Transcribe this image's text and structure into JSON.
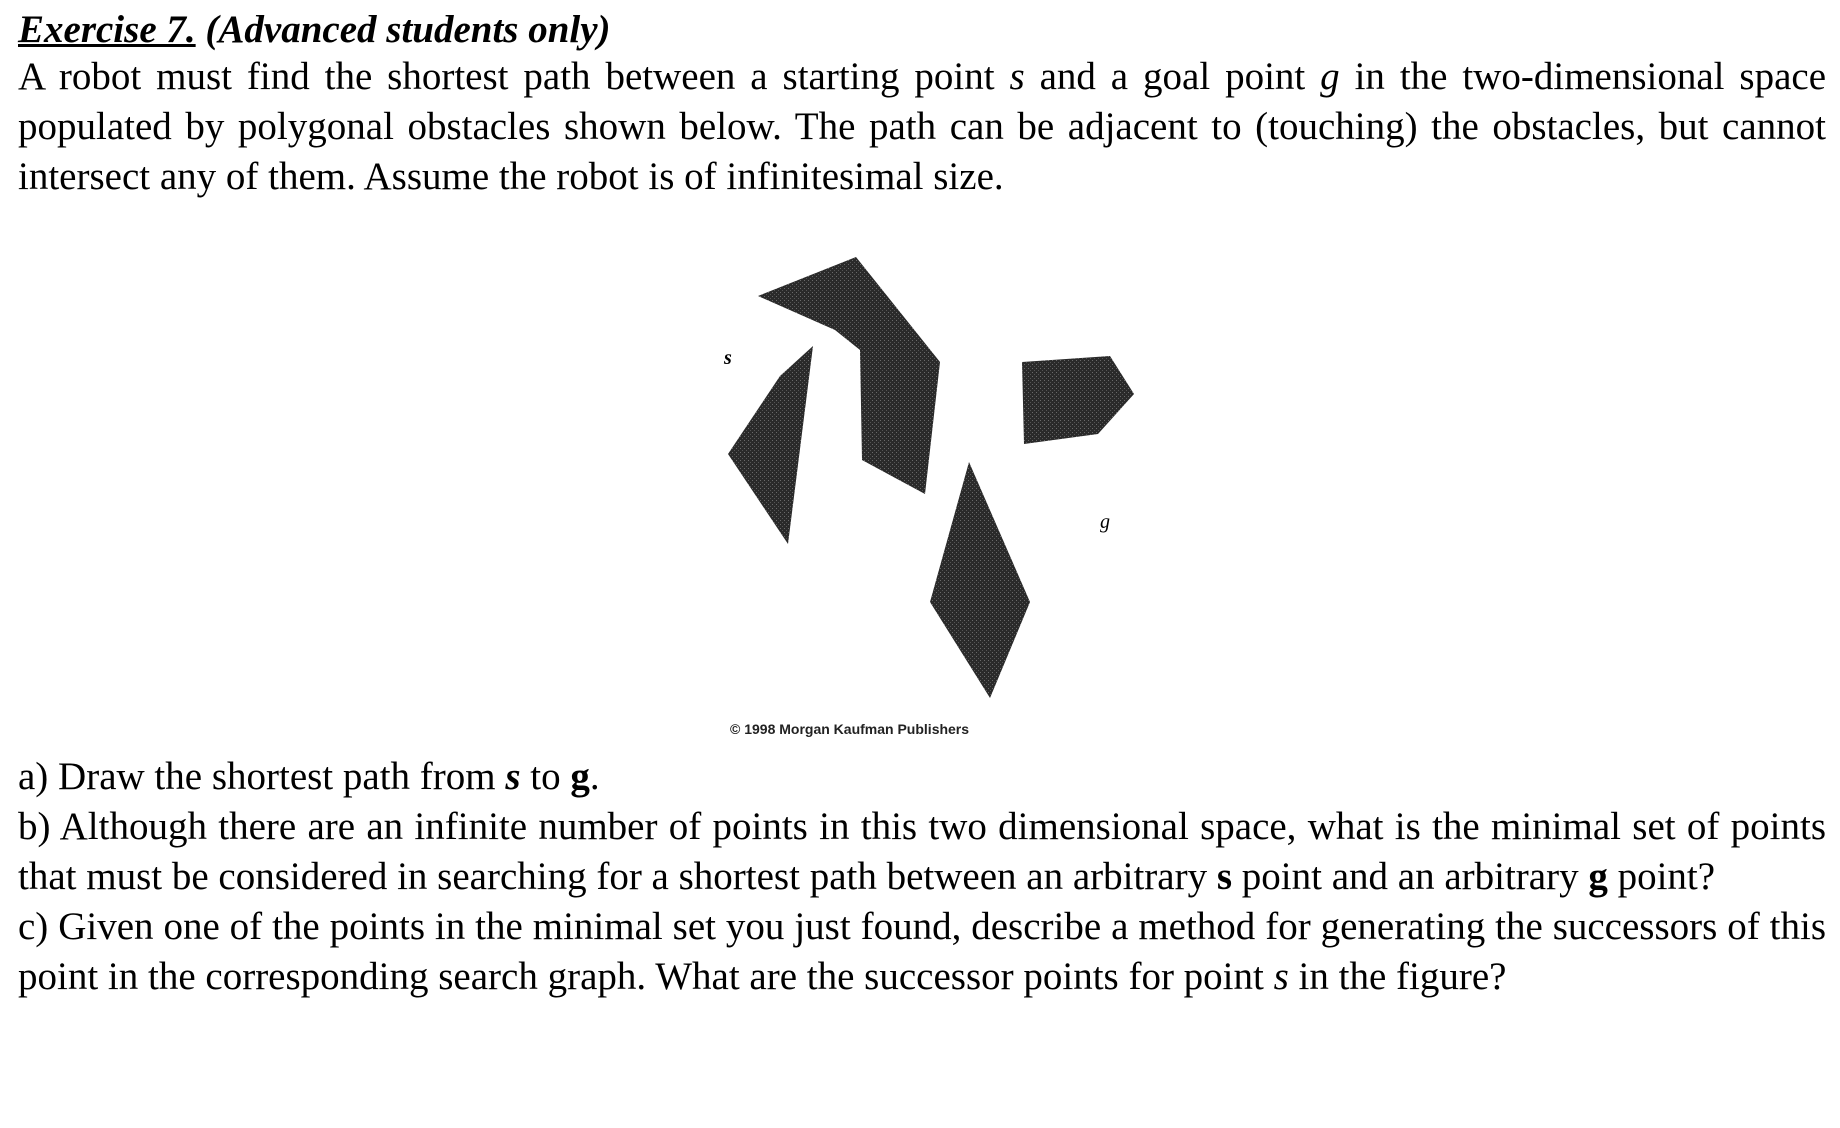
{
  "exercise": {
    "title_underlined": "Exercise 7.",
    "title_rest": " (Advanced students only)",
    "intro_1": "A robot must find the shortest path between a starting point ",
    "intro_s": "s",
    "intro_2": " and a goal point ",
    "intro_g": "g",
    "intro_3": " in the two-dimensional space populated by polygonal obstacles shown below. The path can be adjacent to (touching) the obstacles, but cannot intersect any of them. Assume the robot is of infinitesimal size."
  },
  "figure": {
    "label_s": "s",
    "label_g": "g",
    "copyright": "© 1998 Morgan Kaufman Publishers",
    "obstacle_color": "#2a2a2a"
  },
  "questions": {
    "a_1": "a) Draw the shortest path from ",
    "a_s": "s",
    "a_2": " to ",
    "a_g": "g",
    "a_3": ".",
    "b_1": "b) Although there are an infinite number of points in this two dimensional space, what is the minimal set of points that must be considered in searching for a shortest path between an arbitrary ",
    "b_s": "s",
    "b_2": " point and an arbitrary ",
    "b_g": "g",
    "b_3": " point?",
    "c_1": "c) Given one of the points in the minimal set you just found, describe a method for generating the successors of this point in the corresponding search graph. What are the successor points for point ",
    "c_s": "s",
    "c_2": " in the figure?"
  }
}
